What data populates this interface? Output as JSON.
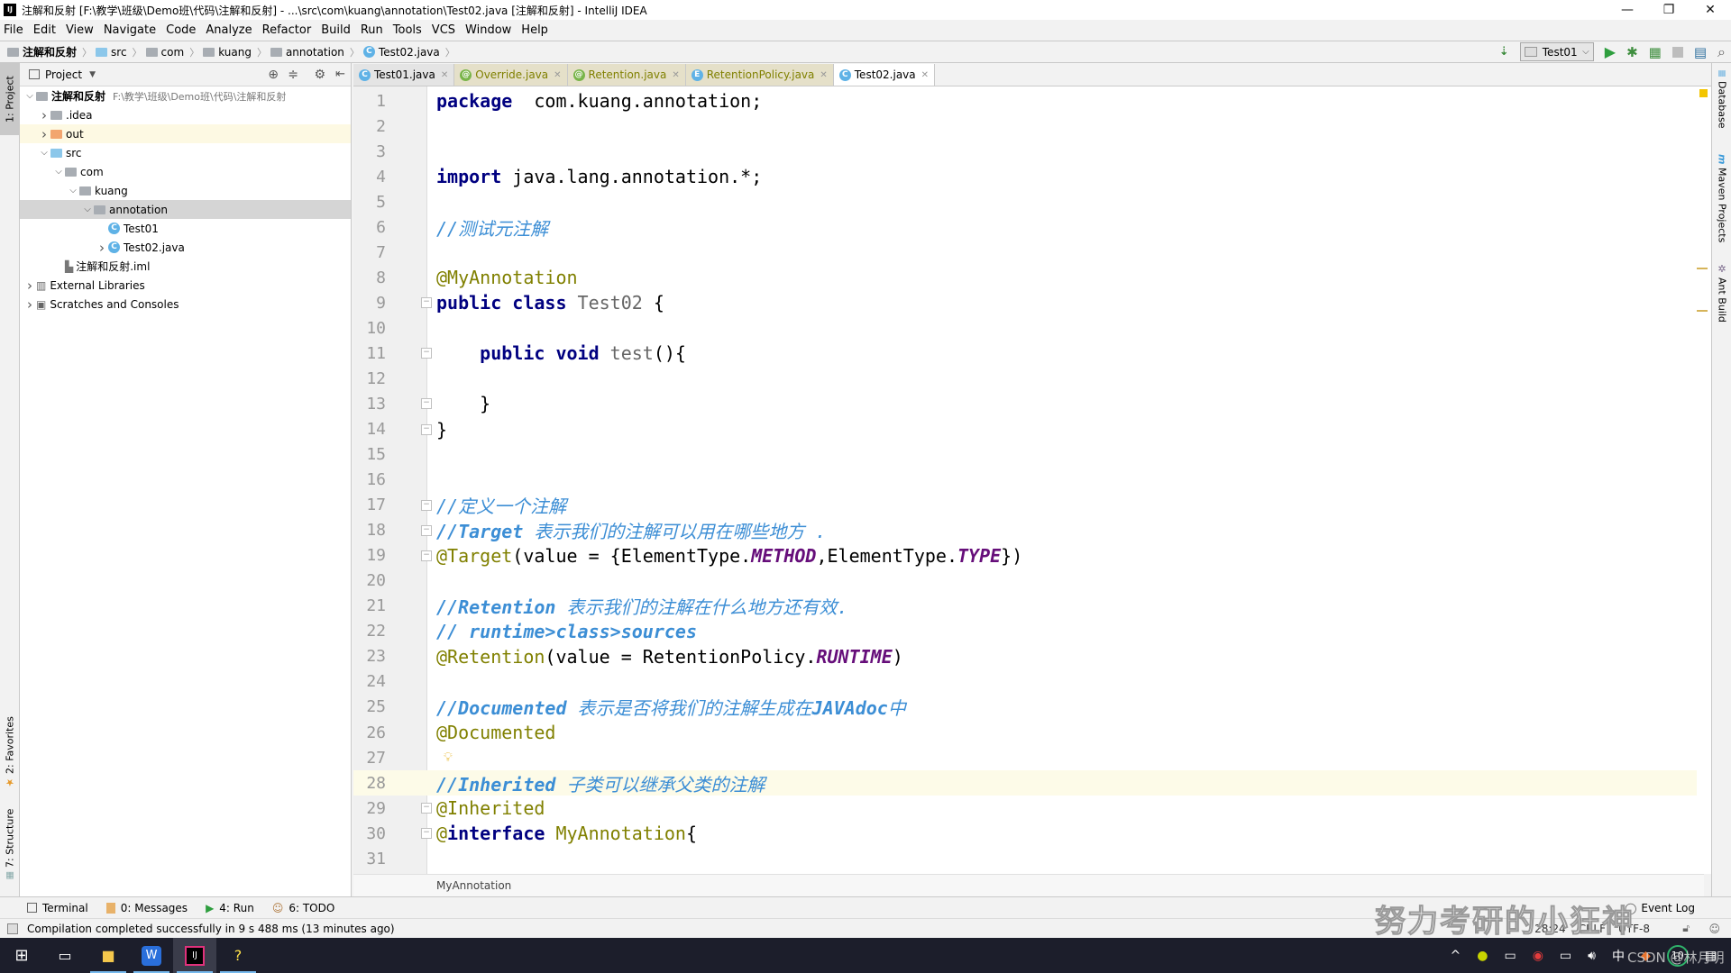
{
  "window": {
    "title": "注解和反射 [F:\\教学\\班级\\Demo班\\代码\\注解和反射] - ...\\src\\com\\kuang\\annotation\\Test02.java [注解和反射] - IntelliJ IDEA",
    "app_icon": "IJ",
    "controls": {
      "minimize": "—",
      "restore": "❐",
      "close": "✕"
    }
  },
  "menu": [
    "File",
    "Edit",
    "View",
    "Navigate",
    "Code",
    "Analyze",
    "Refactor",
    "Build",
    "Run",
    "Tools",
    "VCS",
    "Window",
    "Help"
  ],
  "navbar": {
    "crumbs": [
      "注解和反射",
      "src",
      "com",
      "kuang",
      "annotation",
      "Test02.java"
    ]
  },
  "runbar": {
    "config": "Test01",
    "icons": [
      "build-icon",
      "run-icon",
      "debug-icon",
      "coverage-icon",
      "stop-icon",
      "project-structure-icon",
      "search-icon"
    ]
  },
  "left_strip": {
    "top_tab": "1: Project",
    "favorites": "2: Favorites",
    "structure": "7: Structure"
  },
  "project": {
    "header": "Project",
    "tree": [
      {
        "label": "注解和反射",
        "path": "F:\\教学\\班级\\Demo班\\代码\\注解和反射",
        "depth": 0,
        "arrow": "down",
        "icon": "module",
        "bold": true
      },
      {
        "label": ".idea",
        "depth": 1,
        "arrow": "right",
        "icon": "folder"
      },
      {
        "label": "out",
        "depth": 1,
        "arrow": "right",
        "icon": "folder-orange",
        "highlight": true
      },
      {
        "label": "src",
        "depth": 1,
        "arrow": "down",
        "icon": "folder-blue"
      },
      {
        "label": "com",
        "depth": 2,
        "arrow": "down",
        "icon": "package"
      },
      {
        "label": "kuang",
        "depth": 3,
        "arrow": "down",
        "icon": "package"
      },
      {
        "label": "annotation",
        "depth": 4,
        "arrow": "down",
        "icon": "package",
        "selected": true
      },
      {
        "label": "Test01",
        "depth": 5,
        "arrow": "",
        "icon": "class-run"
      },
      {
        "label": "Test02.java",
        "depth": 5,
        "arrow": "right",
        "icon": "class"
      },
      {
        "label": "注解和反射.iml",
        "depth": 2,
        "arrow": "",
        "icon": "iml"
      },
      {
        "label": "External Libraries",
        "depth": 0,
        "arrow": "right",
        "icon": "libraries"
      },
      {
        "label": "Scratches and Consoles",
        "depth": 0,
        "arrow": "right",
        "icon": "scratches"
      }
    ]
  },
  "tabs": [
    {
      "label": "Test01.java",
      "icon": "C",
      "kind": "class"
    },
    {
      "label": "Override.java",
      "icon": "@",
      "kind": "annotation"
    },
    {
      "label": "Retention.java",
      "icon": "@",
      "kind": "annotation"
    },
    {
      "label": "RetentionPolicy.java",
      "icon": "E",
      "kind": "enum"
    },
    {
      "label": "Test02.java",
      "icon": "C",
      "kind": "class",
      "active": true
    }
  ],
  "editor": {
    "current_line": 28,
    "lines": [
      {
        "n": "1",
        "tokens": [
          [
            "kw",
            "package"
          ],
          [
            "",
            "  com.kuang.annotation;"
          ]
        ]
      },
      {
        "n": "2",
        "tokens": []
      },
      {
        "n": "3",
        "tokens": []
      },
      {
        "n": "4",
        "tokens": [
          [
            "kw",
            "import"
          ],
          [
            "",
            " java.lang.annotation.*;"
          ]
        ]
      },
      {
        "n": "5",
        "tokens": []
      },
      {
        "n": "6",
        "tokens": [
          [
            "cm",
            "//测试元注解"
          ]
        ]
      },
      {
        "n": "7",
        "tokens": []
      },
      {
        "n": "8",
        "tokens": [
          [
            "ann",
            "@MyAnnotation"
          ]
        ]
      },
      {
        "n": "9",
        "tokens": [
          [
            "kw",
            "public class"
          ],
          [
            "dim",
            " Test02"
          ],
          [
            "",
            " {"
          ]
        ],
        "fold": "open"
      },
      {
        "n": "10",
        "tokens": []
      },
      {
        "n": "11",
        "tokens": [
          [
            "",
            " "
          ],
          [
            "kw",
            "   public void"
          ],
          [
            "dim",
            " test"
          ],
          [
            "",
            "(){"
          ]
        ],
        "fold": "open"
      },
      {
        "n": "12",
        "tokens": []
      },
      {
        "n": "13",
        "tokens": [
          [
            "",
            "    }"
          ]
        ],
        "fold": "close"
      },
      {
        "n": "14",
        "tokens": [
          [
            "",
            "}"
          ]
        ],
        "fold": "close"
      },
      {
        "n": "15",
        "tokens": []
      },
      {
        "n": "16",
        "tokens": []
      },
      {
        "n": "17",
        "tokens": [
          [
            "cm",
            "//定义一个注解"
          ]
        ],
        "fold": "open"
      },
      {
        "n": "18",
        "tokens": [
          [
            "cmb",
            "//Target"
          ],
          [
            "cm",
            " 表示我们的注解可以用在哪些地方 ."
          ]
        ],
        "fold": "close"
      },
      {
        "n": "19",
        "tokens": [
          [
            "ann",
            "@Target"
          ],
          [
            "",
            "(value = {ElementType."
          ],
          [
            "en",
            "METHOD"
          ],
          [
            "",
            ",ElementType."
          ],
          [
            "en",
            "TYPE"
          ],
          [
            "",
            "})"
          ]
        ],
        "fold": "open"
      },
      {
        "n": "20",
        "tokens": []
      },
      {
        "n": "21",
        "tokens": [
          [
            "cmb",
            "//Retention"
          ],
          [
            "cm",
            " 表示我们的注解在什么地方还有效."
          ]
        ]
      },
      {
        "n": "22",
        "tokens": [
          [
            "cmb",
            "// runtime>class>sources"
          ]
        ]
      },
      {
        "n": "23",
        "tokens": [
          [
            "ann",
            "@Retention"
          ],
          [
            "",
            "(value = RetentionPolicy."
          ],
          [
            "en",
            "RUNTIME"
          ],
          [
            "",
            ")"
          ]
        ]
      },
      {
        "n": "24",
        "tokens": []
      },
      {
        "n": "25",
        "tokens": [
          [
            "cmb",
            "//Documented"
          ],
          [
            "cm",
            " 表示是否将我们的注解生成在"
          ],
          [
            "cmb",
            "JAVAdoc"
          ],
          [
            "cm",
            "中"
          ]
        ]
      },
      {
        "n": "26",
        "tokens": [
          [
            "ann",
            "@Documented"
          ]
        ]
      },
      {
        "n": "27",
        "tokens": [],
        "bulb": true
      },
      {
        "n": "28",
        "tokens": [
          [
            "cmb",
            "//Inherited"
          ],
          [
            "cm",
            " 子类可以继承父类的注解"
          ]
        ]
      },
      {
        "n": "29",
        "tokens": [
          [
            "ann",
            "@Inherited"
          ]
        ],
        "fold": "close"
      },
      {
        "n": "30",
        "tokens": [
          [
            "ann",
            "@"
          ],
          [
            "kw",
            "interface"
          ],
          [
            "ann",
            " MyAnnotation"
          ],
          [
            "",
            "{"
          ]
        ],
        "fold": "open"
      },
      {
        "n": "31",
        "tokens": []
      }
    ],
    "breadcrumb": "MyAnnotation"
  },
  "right_strip": [
    "Database",
    "Maven Projects",
    "Ant Build"
  ],
  "tool_windows": [
    {
      "label": "Terminal",
      "icon": "terminal-icon"
    },
    {
      "label": "0: Messages",
      "icon": "messages-icon"
    },
    {
      "label": "4: Run",
      "icon": "run-icon"
    },
    {
      "label": "6: TODO",
      "icon": "todo-icon"
    }
  ],
  "event_log": "Event Log",
  "status": {
    "message": "Compilation completed successfully in 9 s 488 ms (13 minutes ago)",
    "position": "28:24",
    "line_sep": "CRLF",
    "encoding": "UTF-8"
  },
  "taskbar": {
    "apps": [
      "start",
      "task-view",
      "file-explorer",
      "wps",
      "intellij-idea",
      "help"
    ],
    "tray_ime": "中",
    "tray_badge": "10"
  },
  "watermark": "努力考研的小狂神",
  "watermark2": "CSDN @林月明"
}
